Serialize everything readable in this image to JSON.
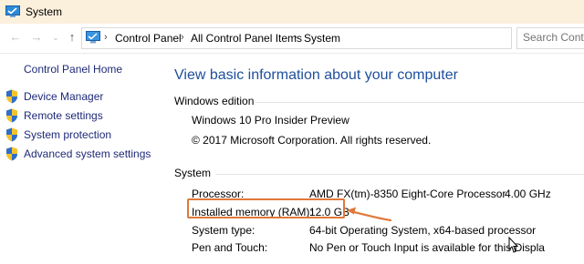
{
  "window": {
    "title": "System",
    "accent": "#1e4f9c"
  },
  "nav": {
    "back_icon": "back-arrow-icon",
    "forward_icon": "forward-arrow-icon",
    "recent_icon": "chevron-down-icon",
    "up_icon": "up-arrow-icon"
  },
  "address": {
    "crumbs": [
      "Control Panel",
      "All Control Panel Items",
      "System"
    ]
  },
  "search": {
    "placeholder": "Search Contro"
  },
  "sidebar": {
    "home": "Control Panel Home",
    "items": [
      {
        "label": "Device Manager",
        "icon": "shield-icon"
      },
      {
        "label": "Remote settings",
        "icon": "shield-icon"
      },
      {
        "label": "System protection",
        "icon": "shield-icon"
      },
      {
        "label": "Advanced system settings",
        "icon": "shield-icon"
      }
    ]
  },
  "main": {
    "heading": "View basic information about your computer",
    "edition": {
      "title": "Windows edition",
      "name": "Windows 10 Pro Insider Preview",
      "copyright": "© 2017 Microsoft Corporation. All rights reserved."
    },
    "system": {
      "title": "System",
      "rows": [
        {
          "label": "Processor:",
          "value": "AMD FX(tm)-8350 Eight-Core Processor",
          "extra": "4.00 GHz"
        },
        {
          "label": "Installed memory (RAM):",
          "value": "12.0 GB"
        },
        {
          "label": "System type:",
          "value": "64-bit Operating System, x64-based processor"
        },
        {
          "label": "Pen and Touch:",
          "value": "No Pen or Touch Input is available for this Displa"
        }
      ]
    },
    "highlight_color": "#e0783a"
  }
}
